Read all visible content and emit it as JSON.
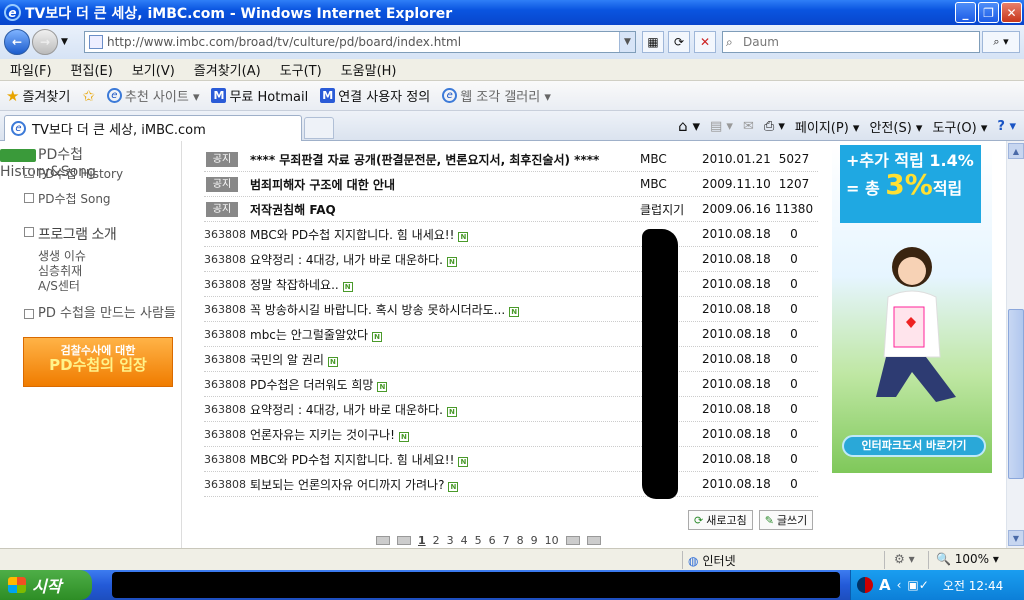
{
  "window": {
    "title": "TV보다 더 큰 세상, iMBC.com - Windows Internet Explorer"
  },
  "address": {
    "url": "http://www.imbc.com/broad/tv/culture/pd/board/index.html"
  },
  "search": {
    "placeholder": "Daum"
  },
  "menu": [
    "파일(F)",
    "편집(E)",
    "보기(V)",
    "즐겨찾기(A)",
    "도구(T)",
    "도움말(H)"
  ],
  "favbar": {
    "favorites": "즐겨찾기",
    "suggested": "추천 사이트 ▾",
    "hotmail": "무료 Hotmail",
    "linked": "연결 사용자 정의",
    "gallery": "웹 조각 갤러리 ▾"
  },
  "tab": {
    "label": "TV보다 더 큰 세상, iMBC.com"
  },
  "commands": {
    "page": "페이지(P) ▾",
    "safety": "안전(S) ▾",
    "tools": "도구(O) ▾"
  },
  "sidebar": {
    "header": "PD수첩 History&Song",
    "history": "PD수첩 History",
    "song": "PD수첩 Song",
    "program": "프로그램 소개",
    "program_items": [
      "생생 이슈",
      "심층취재",
      "A/S센터"
    ],
    "people": "PD 수첩을 만드는 사람들",
    "banner_top": "검찰수사에 대한",
    "banner_big": "PD수첩의 입장"
  },
  "board": {
    "notice_badge": "공지",
    "rows": [
      {
        "num": "",
        "notice": true,
        "subject": "**** 무죄판결 자료 공개(판결문전문, 변론요지서, 최후진술서) ****",
        "author": "MBC",
        "date": "2010.01.21",
        "count": "5027"
      },
      {
        "num": "",
        "notice": true,
        "subject": "범죄피해자 구조에 대한 안내",
        "author": "MBC",
        "date": "2009.11.10",
        "count": "1207"
      },
      {
        "num": "",
        "notice": true,
        "subject": "저작권침해 FAQ",
        "author": "클럽지기",
        "date": "2009.06.16",
        "count": "11380"
      },
      {
        "num": "363808",
        "notice": false,
        "subject": "MBC와 PD수첩 지지합니다. 힘 내세요!!",
        "author": "",
        "date": "2010.08.18",
        "count": "0"
      },
      {
        "num": "363808",
        "notice": false,
        "subject": "요약정리 : 4대강, 내가 바로 대운하다.",
        "author": "",
        "date": "2010.08.18",
        "count": "0"
      },
      {
        "num": "363808",
        "notice": false,
        "subject": "정말 착잡하네요..",
        "author": "",
        "date": "2010.08.18",
        "count": "0"
      },
      {
        "num": "363808",
        "notice": false,
        "subject": "꼭 방송하시길 바랍니다. 혹시 방송 못하시더라도...",
        "author": "",
        "date": "2010.08.18",
        "count": "0"
      },
      {
        "num": "363808",
        "notice": false,
        "subject": "mbc는 안그럴줄알았다",
        "author": "",
        "date": "2010.08.18",
        "count": "0"
      },
      {
        "num": "363808",
        "notice": false,
        "subject": "국민의 알 권리",
        "author": "",
        "date": "2010.08.18",
        "count": "0"
      },
      {
        "num": "363808",
        "notice": false,
        "subject": "PD수첩은 더러워도 희망",
        "author": "",
        "date": "2010.08.18",
        "count": "0"
      },
      {
        "num": "363808",
        "notice": false,
        "subject": "요약정리 : 4대강, 내가 바로 대운하다.",
        "author": "",
        "date": "2010.08.18",
        "count": "0"
      },
      {
        "num": "363808",
        "notice": false,
        "subject": "언론자유는 지키는 것이구나!",
        "author": "",
        "date": "2010.08.18",
        "count": "0"
      },
      {
        "num": "363808",
        "notice": false,
        "subject": "MBC와 PD수첩 지지합니다. 힘 내세요!!",
        "author": "",
        "date": "2010.08.18",
        "count": "0"
      },
      {
        "num": "363808",
        "notice": false,
        "subject": "퇴보되는 언론의자유 어디까지 가려나?",
        "author": "",
        "date": "2010.08.18",
        "count": "0"
      }
    ],
    "refresh": "새로고침",
    "write": "글쓰기",
    "pages": [
      "1",
      "2",
      "3",
      "4",
      "5",
      "6",
      "7",
      "8",
      "9",
      "10"
    ]
  },
  "ad": {
    "line1": "+추가 적립 1.4%",
    "line2_a": "= 총",
    "line2_b": "3%",
    "line2_c": "적립",
    "cta": "인터파크도서 바로가기"
  },
  "status": {
    "zone": "인터넷",
    "zoom": "🔍 100% ▾"
  },
  "taskbar": {
    "start": "시작",
    "clock": "오전 12:44"
  }
}
